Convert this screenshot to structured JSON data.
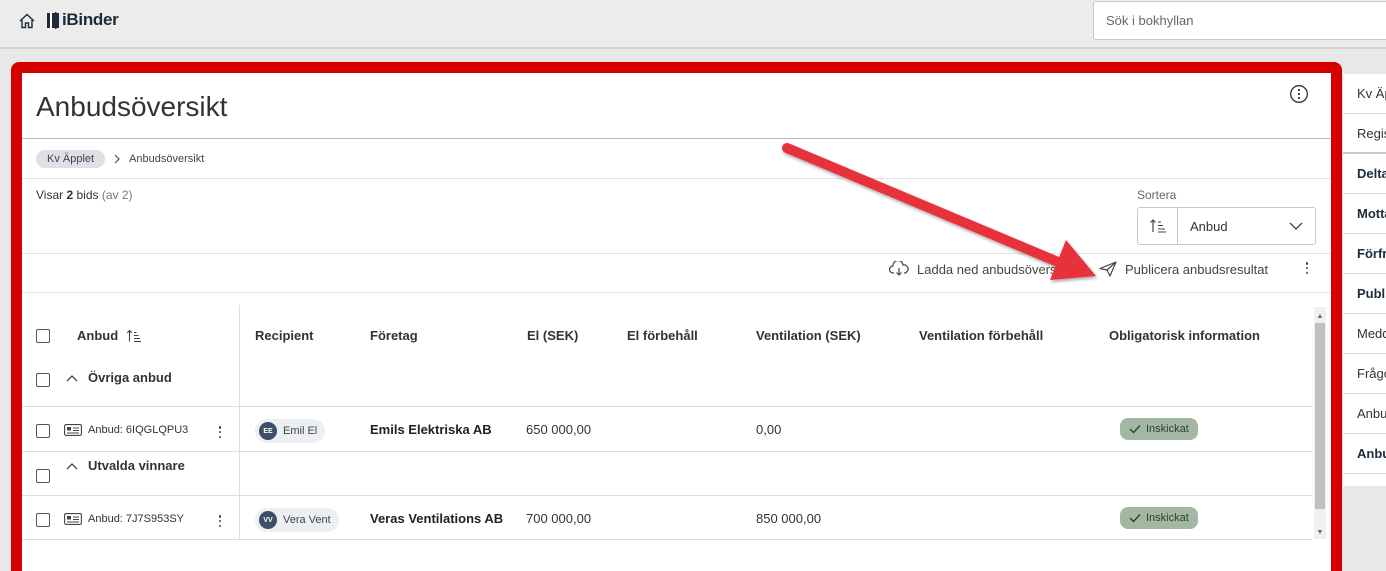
{
  "app": {
    "name": "iBinder"
  },
  "search": {
    "placeholder": "Sök i bokhyllan"
  },
  "page": {
    "title": "Anbudsöversikt"
  },
  "breadcrumb": {
    "items": [
      "Kv Äpplet",
      "Anbudsöversikt"
    ]
  },
  "summary": {
    "prefix": "Visar",
    "count": "2",
    "unit": "bids",
    "total": "(av 2)"
  },
  "sort": {
    "label": "Sortera",
    "value": "Anbud"
  },
  "toolbar": {
    "download": "Ladda ned anbudsöversikt",
    "publish": "Publicera anbudsresultat"
  },
  "table": {
    "headers": [
      "Anbud",
      "Recipient",
      "Företag",
      "El (SEK)",
      "El förbehåll",
      "Ventilation (SEK)",
      "Ventilation förbehåll",
      "Obligatorisk information"
    ],
    "groups": [
      {
        "label": "Övriga anbud",
        "rows": [
          {
            "bid": "Anbud: 6IQGLQPU3",
            "initials": "EE",
            "recipient": "Emil El",
            "company": "Emils Elektriska AB",
            "el": "650 000,00",
            "el_res": "",
            "vent": "0,00",
            "vent_res": "",
            "status": "Inskickat"
          }
        ]
      },
      {
        "label": "Utvalda vinnare",
        "rows": [
          {
            "bid": "Anbud: 7J7S953SY",
            "initials": "VV",
            "recipient": "Vera Vent",
            "company": "Veras Ventilations AB",
            "el": "700 000,00",
            "el_res": "",
            "vent": "850 000,00",
            "vent_res": "",
            "status": "Inskickat"
          }
        ]
      }
    ]
  },
  "sidepanel": {
    "items": [
      "Kv Äpplet",
      "Registrera",
      "Deltagare",
      "Mottagare",
      "Förfrågan",
      "Publicering",
      "Meddelanden",
      "Frågor",
      "Anbud",
      "Anbudsöversikt"
    ]
  },
  "colors": {
    "frame": "#d40000",
    "arrow": "#e8333a",
    "status_bg": "#a3b8a3",
    "avatar_bg": "#3d4f66"
  }
}
